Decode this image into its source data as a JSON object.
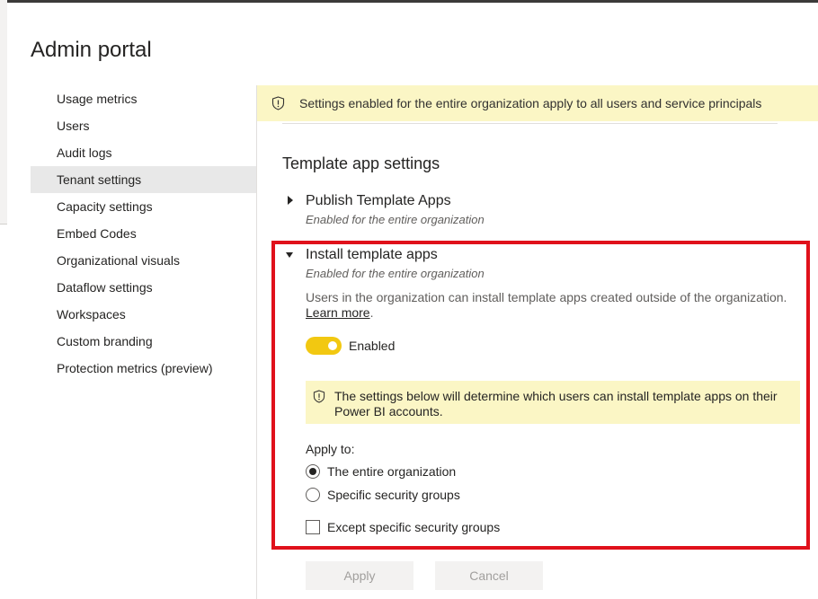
{
  "page": {
    "title": "Admin portal"
  },
  "nav": {
    "items": [
      {
        "label": "Usage metrics"
      },
      {
        "label": "Users"
      },
      {
        "label": "Audit logs"
      },
      {
        "label": "Tenant settings"
      },
      {
        "label": "Capacity settings"
      },
      {
        "label": "Embed Codes"
      },
      {
        "label": "Organizational visuals"
      },
      {
        "label": "Dataflow settings"
      },
      {
        "label": "Workspaces"
      },
      {
        "label": "Custom branding"
      },
      {
        "label": "Protection metrics (preview)"
      }
    ],
    "active": "Tenant settings"
  },
  "banner": {
    "text": "Settings enabled for the entire organization apply to all users and service principals"
  },
  "section": {
    "title": "Template app settings"
  },
  "settings": {
    "publish": {
      "title": "Publish Template Apps",
      "subtitle": "Enabled for the entire organization",
      "expanded": false
    },
    "install": {
      "title": "Install template apps",
      "subtitle": "Enabled for the entire organization",
      "expanded": true,
      "description": "Users in the organization can install template apps created outside of the organization.",
      "learn_more": "Learn more",
      "toggle_label": "Enabled",
      "toggle_on": true,
      "notice": "The settings below will determine which users can install template apps on their Power BI accounts.",
      "apply_to_label": "Apply to:",
      "options": [
        {
          "label": "The entire organization",
          "selected": true
        },
        {
          "label": "Specific security groups",
          "selected": false
        }
      ],
      "except_label": "Except specific security groups",
      "except_checked": false
    }
  },
  "buttons": {
    "apply": "Apply",
    "cancel": "Cancel"
  },
  "colors": {
    "accent": "#f2c811",
    "banner": "#fbf6c5",
    "highlight": "#e0111b",
    "active_nav": "#e8e8e8"
  },
  "icons": {
    "banner": "shield-icon",
    "notice": "shield-icon",
    "collapsed": "caret-right-icon",
    "expanded": "caret-down-icon"
  }
}
